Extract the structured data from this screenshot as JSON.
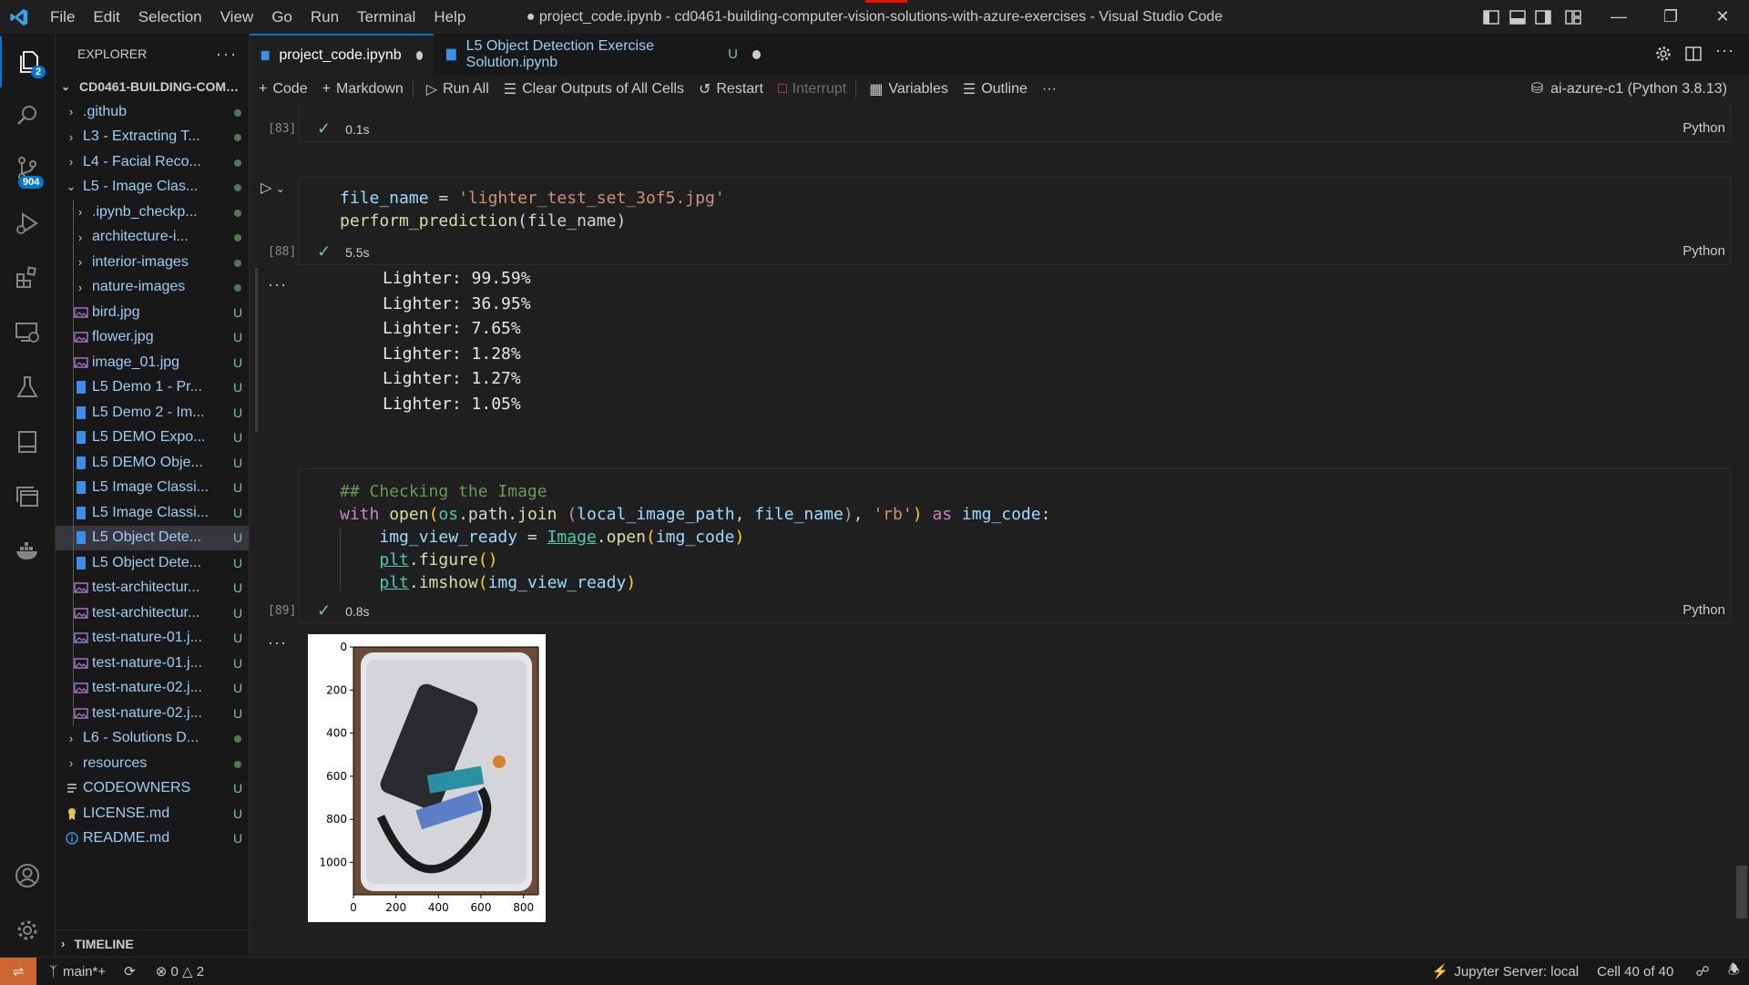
{
  "window": {
    "title": "● project_code.ipynb - cd0461-building-computer-vision-solutions-with-azure-exercises - Visual Studio Code",
    "menu": [
      "File",
      "Edit",
      "Selection",
      "View",
      "Go",
      "Run",
      "Terminal",
      "Help"
    ]
  },
  "activity_bar": {
    "explorer_badge": "2",
    "source_control_badge": "904"
  },
  "sidebar": {
    "header": "EXPLORER",
    "more": "···",
    "project": "CD0461-BUILDING-COMP...",
    "items": [
      {
        "label": ".github",
        "kind": "folder",
        "depth": 1,
        "status": "dot"
      },
      {
        "label": "L3 - Extracting T...",
        "kind": "folder",
        "depth": 1,
        "status": "dot"
      },
      {
        "label": "L4 - Facial Reco...",
        "kind": "folder",
        "depth": 1,
        "status": "dot"
      },
      {
        "label": "L5 - Image Clas...",
        "kind": "folder-open",
        "depth": 1,
        "status": "dot"
      },
      {
        "label": ".ipynb_checkp...",
        "kind": "folder",
        "depth": 2,
        "status": "dot"
      },
      {
        "label": "architecture-i...",
        "kind": "folder",
        "depth": 2,
        "status": "dot"
      },
      {
        "label": "interior-images",
        "kind": "folder",
        "depth": 2,
        "status": "dot"
      },
      {
        "label": "nature-images",
        "kind": "folder",
        "depth": 2,
        "status": "dot"
      },
      {
        "label": "bird.jpg",
        "kind": "image",
        "depth": 2,
        "status": "U"
      },
      {
        "label": "flower.jpg",
        "kind": "image",
        "depth": 2,
        "status": "U"
      },
      {
        "label": "image_01.jpg",
        "kind": "image",
        "depth": 2,
        "status": "U"
      },
      {
        "label": "L5 Demo 1 - Pr...",
        "kind": "notebook",
        "depth": 2,
        "status": "U"
      },
      {
        "label": "L5 Demo 2 - Im...",
        "kind": "notebook",
        "depth": 2,
        "status": "U"
      },
      {
        "label": "L5 DEMO Expo...",
        "kind": "notebook",
        "depth": 2,
        "status": "U"
      },
      {
        "label": "L5 DEMO Obje...",
        "kind": "notebook",
        "depth": 2,
        "status": "U"
      },
      {
        "label": "L5 Image Classi...",
        "kind": "notebook",
        "depth": 2,
        "status": "U"
      },
      {
        "label": "L5 Image Classi...",
        "kind": "notebook",
        "depth": 2,
        "status": "U"
      },
      {
        "label": "L5 Object Dete...",
        "kind": "notebook",
        "depth": 2,
        "status": "U",
        "selected": true
      },
      {
        "label": "L5 Object Dete...",
        "kind": "notebook",
        "depth": 2,
        "status": "U"
      },
      {
        "label": "test-architectur...",
        "kind": "image",
        "depth": 2,
        "status": "U"
      },
      {
        "label": "test-architectur...",
        "kind": "image",
        "depth": 2,
        "status": "U"
      },
      {
        "label": "test-nature-01.j...",
        "kind": "image",
        "depth": 2,
        "status": "U"
      },
      {
        "label": "test-nature-01.j...",
        "kind": "image",
        "depth": 2,
        "status": "U"
      },
      {
        "label": "test-nature-02.j...",
        "kind": "image",
        "depth": 2,
        "status": "U"
      },
      {
        "label": "test-nature-02.j...",
        "kind": "image",
        "depth": 2,
        "status": "U"
      },
      {
        "label": "L6 - Solutions D...",
        "kind": "folder",
        "depth": 1,
        "status": "dot"
      },
      {
        "label": "resources",
        "kind": "folder",
        "depth": 1,
        "status": "dot"
      },
      {
        "label": "CODEOWNERS",
        "kind": "text",
        "depth": 1,
        "status": "U"
      },
      {
        "label": "LICENSE.md",
        "kind": "license",
        "depth": 1,
        "status": "U"
      },
      {
        "label": "README.md",
        "kind": "info",
        "depth": 1,
        "status": "U"
      }
    ],
    "timeline": "TIMELINE"
  },
  "tabs": [
    {
      "label": "project_code.ipynb",
      "active": true,
      "modified": true
    },
    {
      "label": "L5 Object Detection Exercise Solution.ipynb",
      "flag": "U",
      "modified": true
    }
  ],
  "toolbar": {
    "code": "Code",
    "markdown": "Markdown",
    "run_all": "Run All",
    "clear_outputs": "Clear Outputs of All Cells",
    "restart": "Restart",
    "interrupt": "Interrupt",
    "variables": "Variables",
    "outline": "Outline",
    "more": "···",
    "kernel": "ai-azure-c1 (Python 3.8.13)"
  },
  "cells": {
    "c83": {
      "exec": "[83]",
      "time": "0.1s",
      "lang": "Python"
    },
    "c88": {
      "exec": "[88]",
      "time": "5.5s",
      "lang": "Python",
      "line1_var": "file_name",
      "line1_op": " = ",
      "line1_str": "'lighter_test_set_3of5.jpg'",
      "line2_fn": "perform_prediction",
      "line2_rest": "(file_name)",
      "outputs": [
        "Lighter: 99.59%",
        "Lighter: 36.95%",
        "Lighter: 7.65%",
        "Lighter: 1.28%",
        "Lighter: 1.27%",
        "Lighter: 1.05%"
      ]
    },
    "c89": {
      "exec": "[89]",
      "time": "0.8s",
      "lang": "Python",
      "comment": "## Checking the Image",
      "plot_yticks": [
        "0",
        "200",
        "400",
        "600",
        "800",
        "1000"
      ],
      "plot_xticks": [
        "0",
        "200",
        "400",
        "600",
        "800"
      ]
    },
    "more": "···"
  },
  "statusbar": {
    "branch": "main*+",
    "errors": "0",
    "warnings": "2",
    "jupyter": "Jupyter Server: local",
    "cell": "Cell 40 of 40"
  }
}
